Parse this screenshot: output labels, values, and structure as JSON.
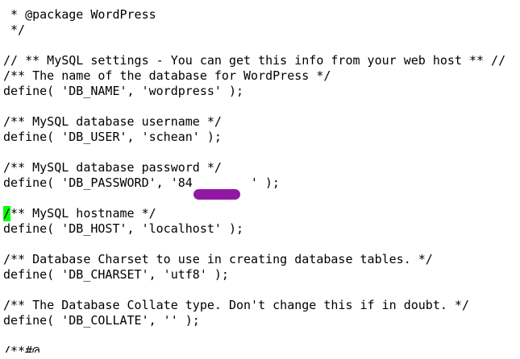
{
  "editor": {
    "lines": [
      " *",
      " * @package WordPress",
      " */",
      "",
      "// ** MySQL settings - You can get this info from your web host ** //",
      "/** The name of the database for WordPress */",
      "define( 'DB_NAME', 'wordpress' );",
      "",
      "/** MySQL database username */",
      "define( 'DB_USER', 'schean' );",
      "",
      "/** MySQL database password */",
      "",
      "",
      "",
      "define( 'DB_HOST', 'localhost' );",
      "",
      "/** Database Charset to use in creating database tables. */",
      "define( 'DB_CHARSET', 'utf8' );",
      "",
      "/** The Database Collate type. Don't change this if in doubt. */",
      "define( 'DB_COLLATE', '' );",
      "",
      "/**#@"
    ],
    "password_line": {
      "prefix": "define( 'DB_PASSWORD', '84",
      "redacted_visible": "",
      "suffix": "' );"
    },
    "cursor_line": {
      "cursor_char": "/",
      "rest": "** MySQL hostname */"
    },
    "colors": {
      "background": "#ffffff",
      "text": "#000000",
      "cursor": "#00ff00",
      "redaction": "#8b0c9e"
    }
  }
}
